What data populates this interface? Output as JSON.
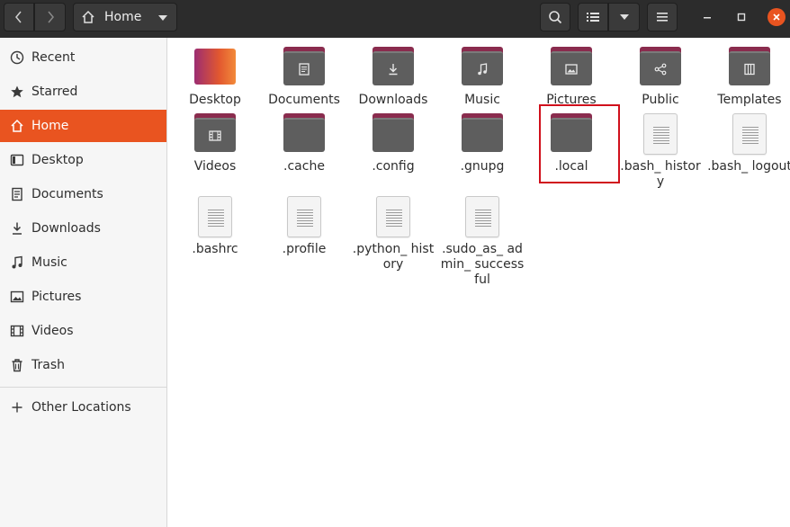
{
  "header": {
    "path_label": "Home",
    "icons": {
      "back": "chevron-left-icon",
      "forward": "chevron-right-icon",
      "home": "home-icon",
      "search": "search-icon",
      "view": "list-view-icon",
      "menu": "hamburger-icon",
      "minimize": "minimize-icon",
      "maximize": "maximize-icon",
      "close": "close-icon"
    },
    "close_color": "#e95420"
  },
  "sidebar": {
    "items": [
      {
        "label": "Recent",
        "icon": "clock-icon"
      },
      {
        "label": "Starred",
        "icon": "star-icon"
      },
      {
        "label": "Home",
        "icon": "home-icon",
        "active": true
      },
      {
        "label": "Desktop",
        "icon": "desktop-icon"
      },
      {
        "label": "Documents",
        "icon": "document-icon"
      },
      {
        "label": "Downloads",
        "icon": "download-icon"
      },
      {
        "label": "Music",
        "icon": "music-icon"
      },
      {
        "label": "Pictures",
        "icon": "picture-icon"
      },
      {
        "label": "Videos",
        "icon": "video-icon"
      },
      {
        "label": "Trash",
        "icon": "trash-icon"
      }
    ],
    "other_locations": {
      "label": "Other Locations",
      "icon": "plus-icon"
    },
    "active_color": "#e95420"
  },
  "files": [
    {
      "name": "Desktop",
      "kind": "desktop"
    },
    {
      "name": "Documents",
      "kind": "folder",
      "emblem": "document-emblem-icon"
    },
    {
      "name": "Downloads",
      "kind": "folder",
      "emblem": "download-emblem-icon"
    },
    {
      "name": "Music",
      "kind": "folder",
      "emblem": "music-emblem-icon"
    },
    {
      "name": "Pictures",
      "kind": "folder",
      "emblem": "picture-emblem-icon"
    },
    {
      "name": "Public",
      "kind": "folder",
      "emblem": "share-emblem-icon"
    },
    {
      "name": "Templates",
      "kind": "folder",
      "emblem": "template-emblem-icon"
    },
    {
      "name": "Videos",
      "kind": "folder",
      "emblem": "video-emblem-icon"
    },
    {
      "name": ".cache",
      "kind": "folder"
    },
    {
      "name": ".config",
      "kind": "folder"
    },
    {
      "name": ".gnupg",
      "kind": "folder"
    },
    {
      "name": ".local",
      "kind": "folder",
      "highlighted": true
    },
    {
      "name": ".bash_ history",
      "kind": "file"
    },
    {
      "name": ".bash_ logout",
      "kind": "file"
    },
    {
      "name": ".bashrc",
      "kind": "file"
    },
    {
      "name": ".profile",
      "kind": "file"
    },
    {
      "name": ".python_ history",
      "kind": "file"
    },
    {
      "name": ".sudo_as_ admin_ successful",
      "kind": "file"
    }
  ],
  "highlight_color": "#d0101c"
}
